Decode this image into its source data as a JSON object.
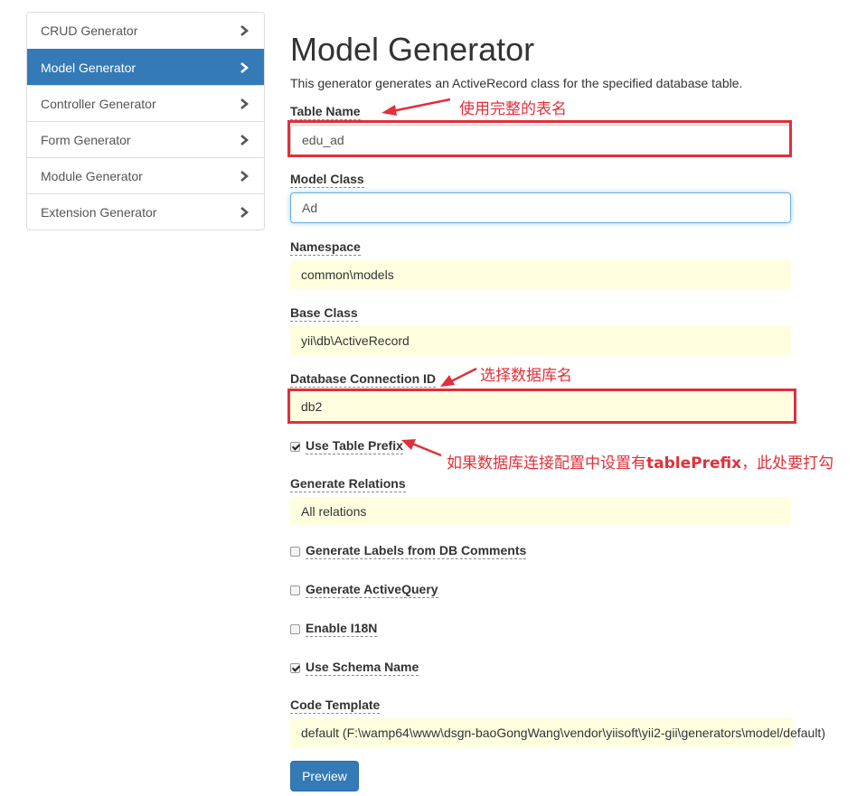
{
  "sidebar": {
    "items": [
      {
        "label": "CRUD Generator",
        "active": false
      },
      {
        "label": "Model Generator",
        "active": true
      },
      {
        "label": "Controller Generator",
        "active": false
      },
      {
        "label": "Form Generator",
        "active": false
      },
      {
        "label": "Module Generator",
        "active": false
      },
      {
        "label": "Extension Generator",
        "active": false
      }
    ]
  },
  "page": {
    "title": "Model Generator",
    "description": "This generator generates an ActiveRecord class for the specified database table."
  },
  "form": {
    "table_name": {
      "label": "Table Name",
      "value": "edu_ad"
    },
    "model_class": {
      "label": "Model Class",
      "value": "Ad"
    },
    "namespace": {
      "label": "Namespace",
      "value": "common\\models"
    },
    "base_class": {
      "label": "Base Class",
      "value": "yii\\db\\ActiveRecord"
    },
    "db_connection": {
      "label": "Database Connection ID",
      "value": "db2"
    },
    "use_table_prefix": {
      "label": "Use Table Prefix",
      "checked": true
    },
    "generate_relations": {
      "label": "Generate Relations",
      "value": "All relations"
    },
    "generate_labels": {
      "label": "Generate Labels from DB Comments",
      "checked": false
    },
    "generate_active_query": {
      "label": "Generate ActiveQuery",
      "checked": false
    },
    "enable_i18n": {
      "label": "Enable I18N",
      "checked": false
    },
    "use_schema_name": {
      "label": "Use Schema Name",
      "checked": true
    },
    "code_template": {
      "label": "Code Template",
      "value": "default (F:\\wamp64\\www\\dsgn-baoGongWang\\vendor\\yiisoft\\yii2-gii\\generators\\model/default)"
    },
    "preview_label": "Preview"
  },
  "annotations": {
    "table_name_note": "使用完整的表名",
    "db_note": "选择数据库名",
    "prefix_note_prefix": "如果数据库连接配置中设置有",
    "prefix_note_bold": "tablePrefix",
    "prefix_note_suffix": "，此处要打勾",
    "color": "#e0303a"
  },
  "colors": {
    "primary": "#337ab7",
    "sticky_bg": "#ffffe0"
  }
}
